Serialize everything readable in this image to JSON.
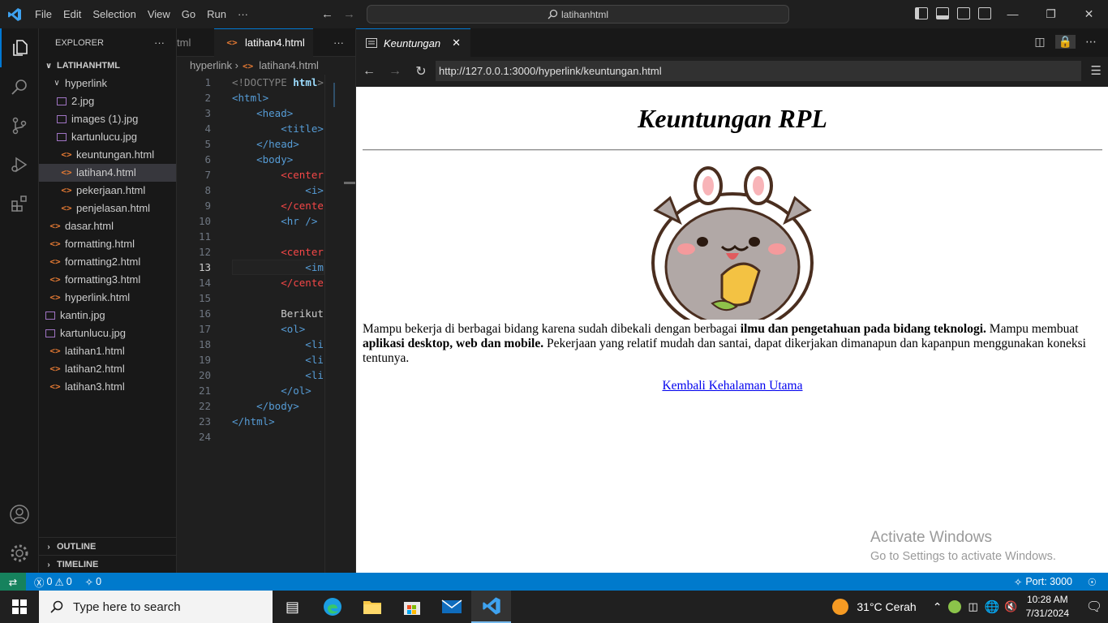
{
  "menu": [
    "File",
    "Edit",
    "Selection",
    "View",
    "Go",
    "Run",
    "···"
  ],
  "search_box": "latihanhtml",
  "window_buttons": {
    "minimize": "—",
    "restore": "❐",
    "close": "✕"
  },
  "explorer": {
    "title": "EXPLORER",
    "more": "···",
    "root": "LATIHANHTML",
    "folder": "hyperlink",
    "folder_files": [
      {
        "name": "2.jpg",
        "type": "img"
      },
      {
        "name": "images (1).jpg",
        "type": "img"
      },
      {
        "name": "kartunlucu.jpg",
        "type": "img"
      },
      {
        "name": "keuntungan.html",
        "type": "html"
      },
      {
        "name": "latihan4.html",
        "type": "html",
        "selected": true
      },
      {
        "name": "pekerjaan.html",
        "type": "html"
      },
      {
        "name": "penjelasan.html",
        "type": "html"
      }
    ],
    "root_files": [
      {
        "name": "dasar.html",
        "type": "html"
      },
      {
        "name": "formatting.html",
        "type": "html"
      },
      {
        "name": "formatting2.html",
        "type": "html"
      },
      {
        "name": "formatting3.html",
        "type": "html"
      },
      {
        "name": "hyperlink.html",
        "type": "html"
      },
      {
        "name": "kantin.jpg",
        "type": "img"
      },
      {
        "name": "kartunlucu.jpg",
        "type": "img"
      },
      {
        "name": "latihan1.html",
        "type": "html"
      },
      {
        "name": "latihan2.html",
        "type": "html"
      },
      {
        "name": "latihan3.html",
        "type": "html"
      }
    ],
    "outline": "OUTLINE",
    "timeline": "TIMELINE"
  },
  "editor": {
    "prev_tab": "tml",
    "tab": "latihan4.html",
    "more": "···",
    "breadcrumb": [
      "hyperlink",
      "latihan4.html"
    ],
    "current_line": 13,
    "lines": [
      [
        {
          "t": "<!DOCTYPE ",
          "c": "k-doc"
        },
        {
          "t": "html",
          "c": "k-bold"
        },
        {
          "t": ">",
          "c": "k-doc"
        }
      ],
      [
        {
          "t": "<html>",
          "c": "k-tag"
        }
      ],
      [
        {
          "t": "    <head>",
          "c": "k-tag"
        }
      ],
      [
        {
          "t": "        <title>",
          "c": "k-tag"
        }
      ],
      [
        {
          "t": "    </head>",
          "c": "k-tag"
        }
      ],
      [
        {
          "t": "    <body>",
          "c": "k-tag"
        }
      ],
      [
        {
          "t": "        <center",
          "c": "k-red"
        }
      ],
      [
        {
          "t": "            <i>",
          "c": "k-tag"
        }
      ],
      [
        {
          "t": "        </cente",
          "c": "k-red"
        }
      ],
      [
        {
          "t": "        <hr />",
          "c": "k-tag"
        }
      ],
      [
        {
          "t": "",
          "c": "k-txt"
        }
      ],
      [
        {
          "t": "        <center",
          "c": "k-red"
        }
      ],
      [
        {
          "t": "            <im",
          "c": "k-tag"
        }
      ],
      [
        {
          "t": "        </cente",
          "c": "k-red"
        }
      ],
      [
        {
          "t": "",
          "c": "k-txt"
        }
      ],
      [
        {
          "t": "        Berikut",
          "c": "k-txt"
        }
      ],
      [
        {
          "t": "        <ol>",
          "c": "k-tag"
        }
      ],
      [
        {
          "t": "            <li",
          "c": "k-tag"
        }
      ],
      [
        {
          "t": "            <li",
          "c": "k-tag"
        }
      ],
      [
        {
          "t": "            <li",
          "c": "k-tag"
        }
      ],
      [
        {
          "t": "        </ol>",
          "c": "k-tag"
        }
      ],
      [
        {
          "t": "    </body>",
          "c": "k-tag"
        }
      ],
      [
        {
          "t": "</html>",
          "c": "k-tag"
        }
      ],
      [
        {
          "t": "",
          "c": "k-txt"
        }
      ]
    ]
  },
  "browser": {
    "tab_title": "Keuntungan",
    "url": "http://127.0.0.1:3000/hyperlink/keuntungan.html",
    "page": {
      "heading": "Keuntungan RPL",
      "p1": "Mampu bekerja di berbagai bidang karena sudah dibekali dengan berbagai ",
      "b1": "ilmu dan pengetahuan pada bidang teknologi.",
      "p2": " Mampu membuat ",
      "b2": "aplikasi desktop, web dan mobile.",
      "p3": " Pekerjaan yang relatif mudah dan santai, dapat dikerjakan dimanapun dan kapanpun menggunakan koneksi tentunya.",
      "link": "Kembali Kehalaman Utama"
    },
    "watermark": {
      "line1": "Activate Windows",
      "line2": "Go to Settings to activate Windows."
    }
  },
  "status": {
    "errors": "0",
    "warnings": "0",
    "ports_count": "0",
    "port": "Port: 3000"
  },
  "taskbar": {
    "search": "Type here to search",
    "weather": "31°C  Cerah",
    "time": "10:28 AM",
    "date": "7/31/2024"
  }
}
